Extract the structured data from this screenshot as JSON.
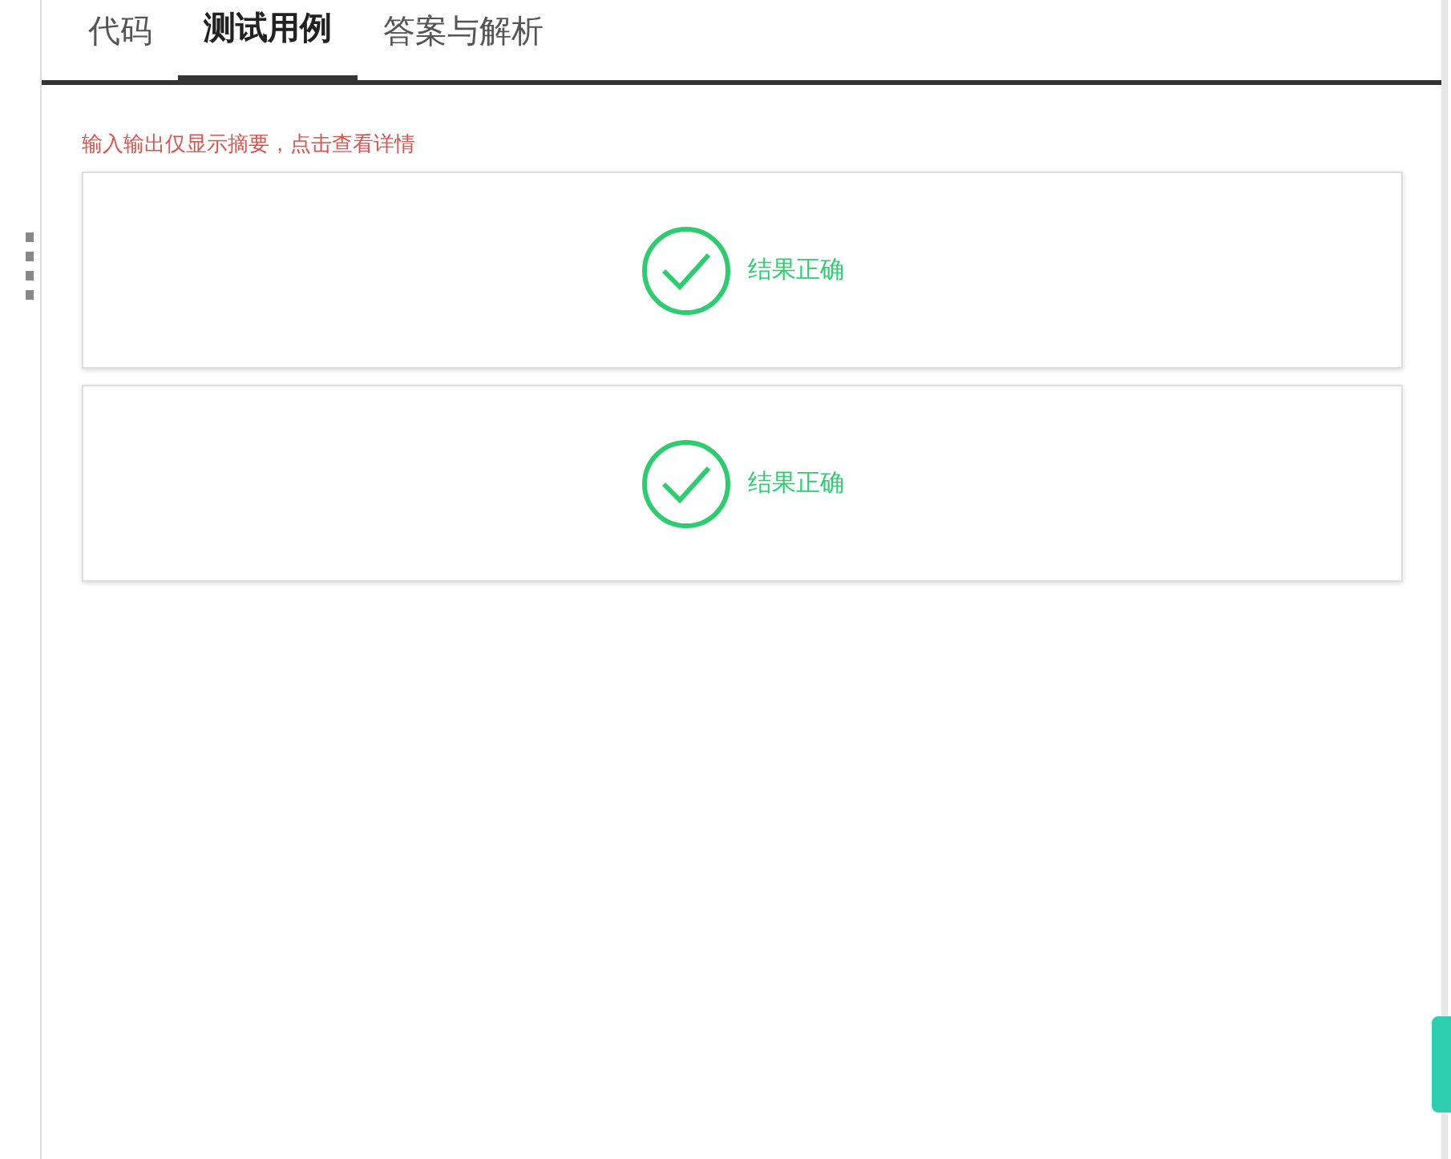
{
  "tabs": [
    {
      "label": "代码",
      "selected": false
    },
    {
      "label": "测试用例",
      "selected": true
    },
    {
      "label": "答案与解析",
      "selected": false
    }
  ],
  "notice": "输入输出仅显示摘要，点击查看详情",
  "cases": [
    {
      "passed": true,
      "result": "结果正确"
    },
    {
      "passed": true,
      "result": "结果正确"
    }
  ]
}
